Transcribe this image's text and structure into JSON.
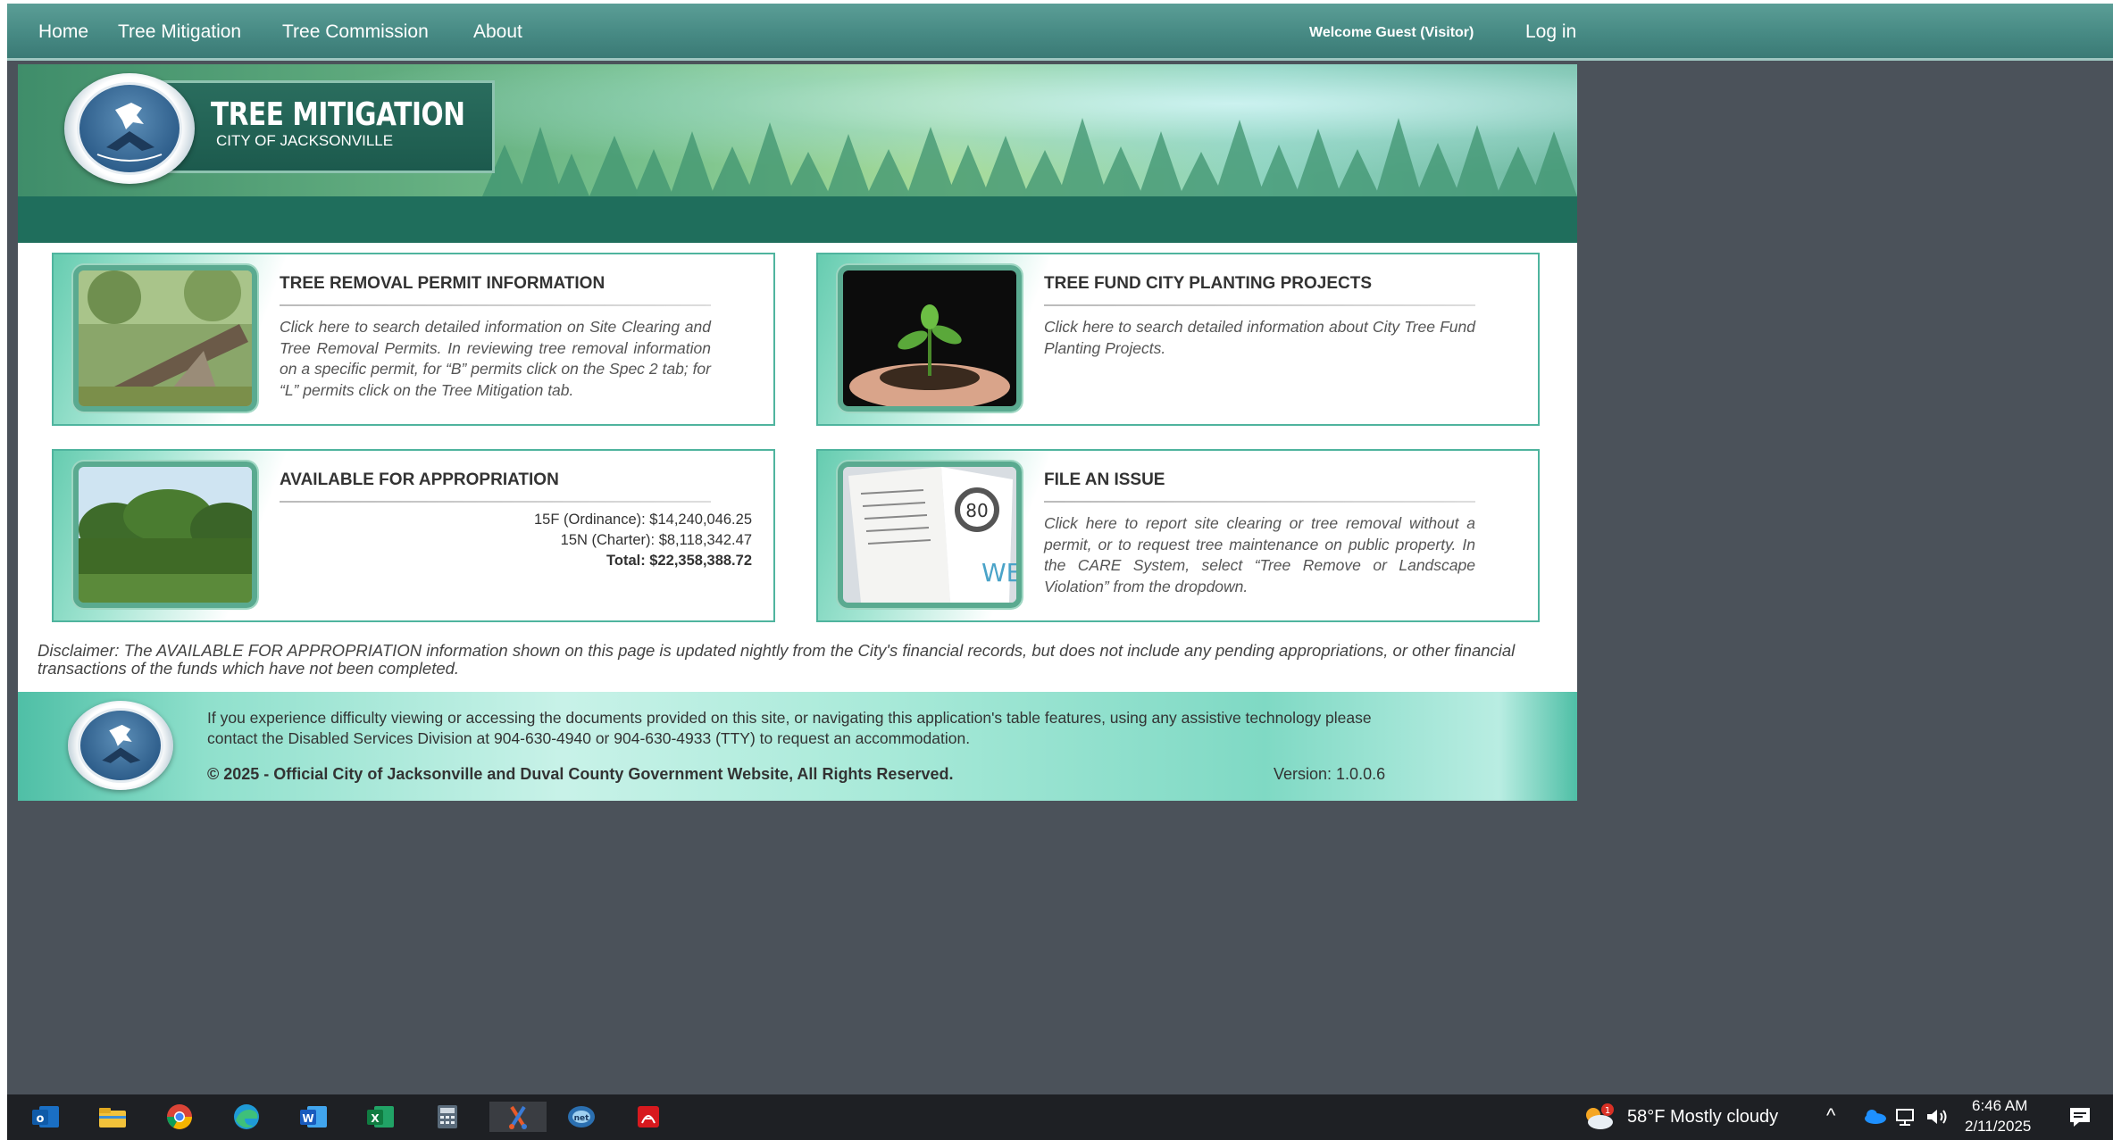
{
  "nav": {
    "home": "Home",
    "tree_mitigation": "Tree Mitigation",
    "tree_commission": "Tree Commission",
    "about": "About",
    "welcome": "Welcome Guest (Visitor)",
    "login": "Log in"
  },
  "banner": {
    "title": "TREE MITIGATION",
    "subtitle": "CITY OF JACKSONVILLE"
  },
  "cards": [
    {
      "title": "TREE REMOVAL PERMIT INFORMATION",
      "description": "Click here to search detailed information on Site Clearing and Tree Removal Permits. In reviewing tree removal information on a specific permit, for “B” permits click on the Spec 2 tab; for “L” permits click on the Tree Mitigation tab."
    },
    {
      "title": "TREE FUND CITY PLANTING PROJECTS",
      "description": "Click here to search detailed information about City Tree Fund Planting Projects."
    },
    {
      "title": "AVAILABLE FOR APPROPRIATION",
      "line1": "15F (Ordinance): $14,240,046.25",
      "line2": "15N (Charter): $8,118,342.47",
      "total": "Total: $22,358,388.72"
    },
    {
      "title": "FILE AN ISSUE",
      "description": "Click here to report site clearing or tree removal without a permit, or to request tree maintenance on public property. In the CARE System, select “Tree Remove or Landscape Violation” from the dropdown."
    }
  ],
  "disclaimer": "Disclaimer: The AVAILABLE FOR APPROPRIATION information shown on this page is updated nightly from the City's financial records, but does not include any pending appropriations, or other financial transactions of the funds which have not been completed.",
  "footer": {
    "accessibility": "If you experience difficulty viewing or accessing the documents provided on this site, or navigating this application's table features, using any assistive technology please contact the Disabled Services Division at 904-630-4940 or 904-630-4933 (TTY) to request an accommodation.",
    "copyright": "© 2025 - Official City of Jacksonville and Duval County Government Website, All Rights Reserved.",
    "version": "Version: 1.0.0.6"
  },
  "taskbar": {
    "apps": [
      "outlook-icon",
      "file-explorer-icon",
      "chrome-icon",
      "edge-icon",
      "word-icon",
      "excel-icon",
      "calculator-icon",
      "snipping-tool-icon",
      "network-app-icon",
      "acrobat-icon"
    ],
    "weather": "58°F  Mostly cloudy",
    "weather_badge": "1",
    "time": "6:46 AM",
    "date": "2/11/2025"
  },
  "colors": {
    "nav": "#478a84",
    "banner_stripe": "#1f6e5c",
    "card_border": "#4fb49e",
    "background": "#4b525a",
    "taskbar": "#1e2024"
  }
}
